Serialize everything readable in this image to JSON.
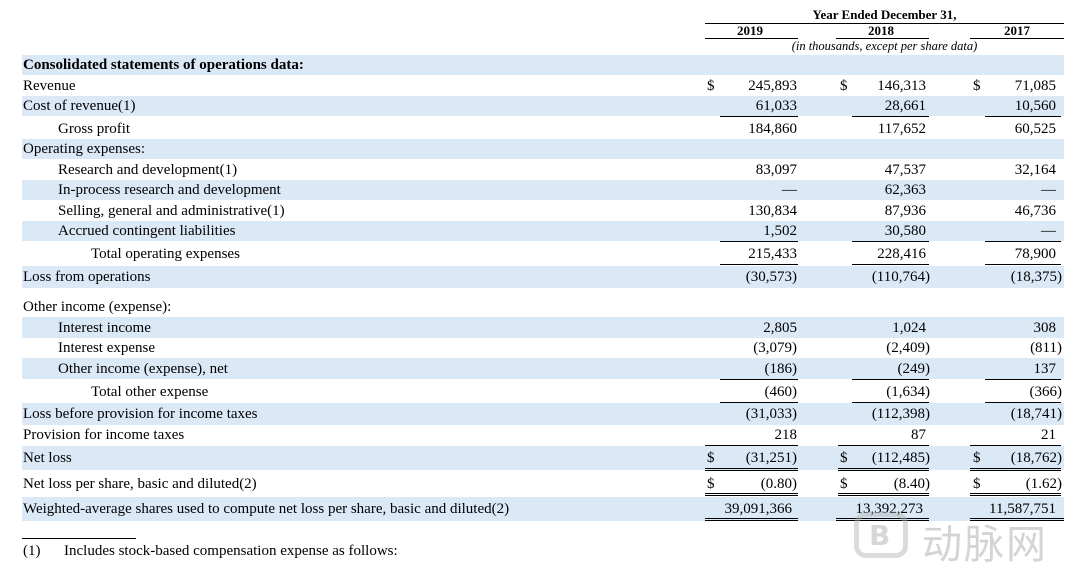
{
  "header": {
    "period_title": "Year Ended December 31,",
    "years": [
      "2019",
      "2018",
      "2017"
    ],
    "units_note": "(in thousands, except per share data)"
  },
  "currency_symbol": "$",
  "rows": [
    {
      "label": "Consolidated statements of operations data:",
      "values": [
        "",
        "",
        ""
      ]
    },
    {
      "label": "Revenue",
      "values": [
        "245,893",
        "146,313",
        "71,085"
      ]
    },
    {
      "label": "Cost of revenue(1)",
      "values": [
        "61,033",
        "28,661",
        "10,560"
      ]
    },
    {
      "label": "Gross profit",
      "values": [
        "184,860",
        "117,652",
        "60,525"
      ]
    },
    {
      "label": "Operating expenses:",
      "values": [
        "",
        "",
        ""
      ]
    },
    {
      "label": "Research and development(1)",
      "values": [
        "83,097",
        "47,537",
        "32,164"
      ]
    },
    {
      "label": "In-process research and development",
      "values": [
        "—",
        "62,363",
        "—"
      ]
    },
    {
      "label": "Selling, general and administrative(1)",
      "values": [
        "130,834",
        "87,936",
        "46,736"
      ]
    },
    {
      "label": "Accrued contingent liabilities",
      "values": [
        "1,502",
        "30,580",
        "—"
      ]
    },
    {
      "label": "Total operating expenses",
      "values": [
        "215,433",
        "228,416",
        "78,900"
      ]
    },
    {
      "label": "Loss from operations",
      "values": [
        "(30,573)",
        "(110,764)",
        "(18,375)"
      ]
    },
    {
      "label": "Other income (expense):",
      "values": [
        "",
        "",
        ""
      ]
    },
    {
      "label": "Interest income",
      "values": [
        "2,805",
        "1,024",
        "308"
      ]
    },
    {
      "label": "Interest expense",
      "values": [
        "(3,079)",
        "(2,409)",
        "(811)"
      ]
    },
    {
      "label": "Other income (expense), net",
      "values": [
        "(186)",
        "(249)",
        "137"
      ]
    },
    {
      "label": "Total other expense",
      "values": [
        "(460)",
        "(1,634)",
        "(366)"
      ]
    },
    {
      "label": "Loss before provision for income taxes",
      "values": [
        "(31,033)",
        "(112,398)",
        "(18,741)"
      ]
    },
    {
      "label": "Provision for income taxes",
      "values": [
        "218",
        "87",
        "21"
      ]
    },
    {
      "label": "Net loss",
      "values": [
        "(31,251)",
        "(112,485)",
        "(18,762)"
      ]
    },
    {
      "label": "Net loss per share, basic and diluted(2)",
      "values": [
        "(0.80)",
        "(8.40)",
        "(1.62)"
      ]
    },
    {
      "label": "Weighted-average shares used to compute net loss per share, basic and diluted(2)",
      "values": [
        "39,091,366",
        "13,392,273",
        "11,587,751"
      ]
    }
  ],
  "footnote": {
    "marker": "(1)",
    "text": "Includes stock-based compensation expense as follows:"
  },
  "watermark": {
    "text": "动脉网",
    "logo_glyph": "B"
  }
}
